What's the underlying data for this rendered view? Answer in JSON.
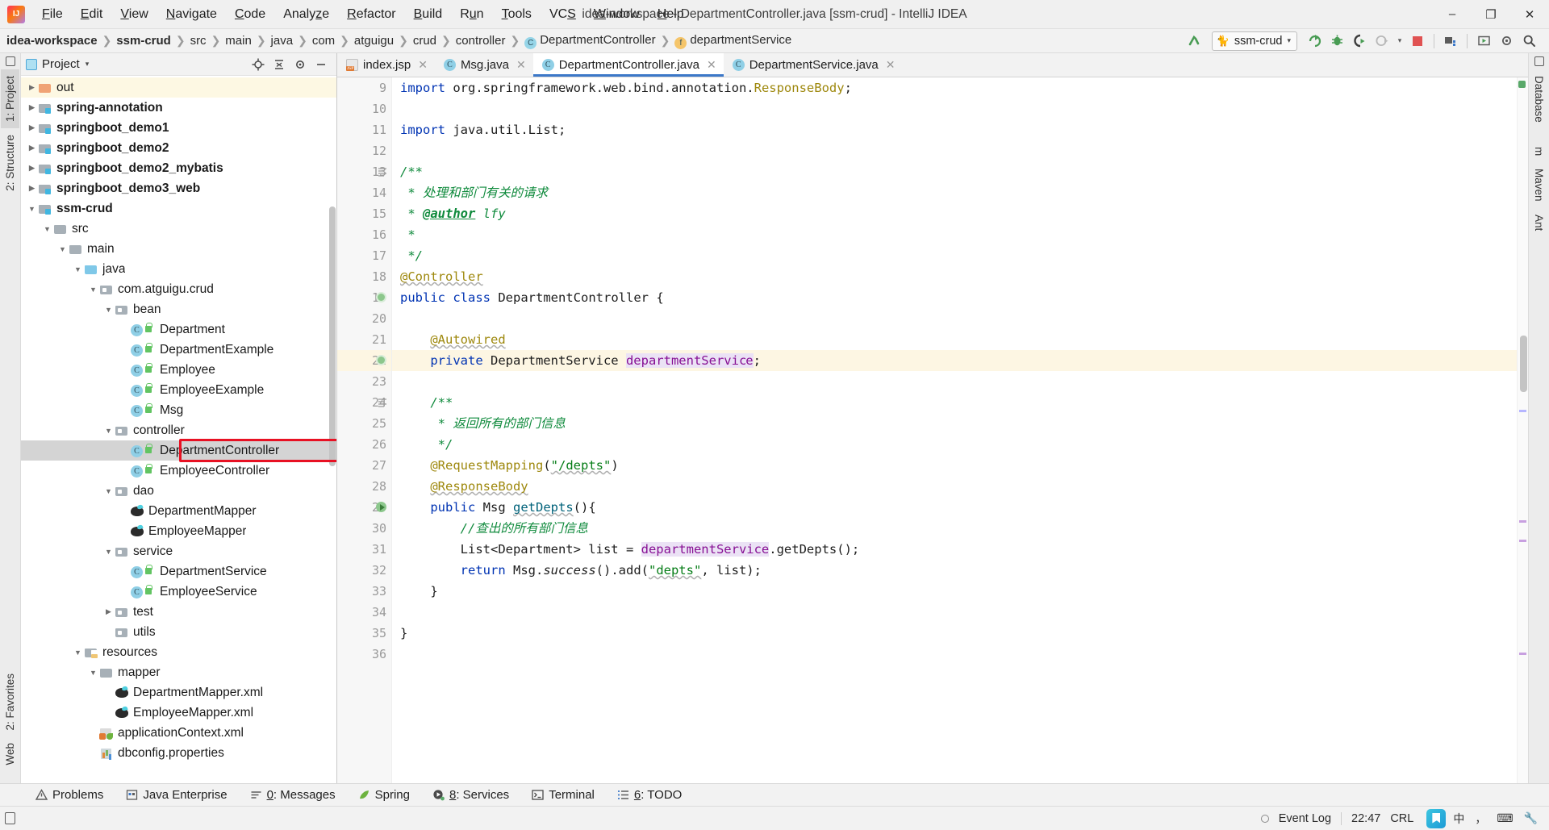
{
  "window": {
    "title": "idea-workspace - DepartmentController.java [ssm-crud] - IntelliJ IDEA",
    "minimize": "–",
    "maximize": "❐",
    "close": "✕"
  },
  "menubar": [
    {
      "label": "File"
    },
    {
      "label": "Edit"
    },
    {
      "label": "View"
    },
    {
      "label": "Navigate"
    },
    {
      "label": "Code"
    },
    {
      "label": "Analyze"
    },
    {
      "label": "Refactor"
    },
    {
      "label": "Build"
    },
    {
      "label": "Run"
    },
    {
      "label": "Tools"
    },
    {
      "label": "VCS"
    },
    {
      "label": "Window"
    },
    {
      "label": "Help"
    }
  ],
  "breadcrumb": {
    "separator": "❯",
    "items": [
      {
        "label": "idea-workspace",
        "bold": true,
        "icon": ""
      },
      {
        "label": "ssm-crud",
        "bold": true,
        "icon": ""
      },
      {
        "label": "src",
        "bold": false,
        "icon": ""
      },
      {
        "label": "main",
        "bold": false,
        "icon": ""
      },
      {
        "label": "java",
        "bold": false,
        "icon": ""
      },
      {
        "label": "com",
        "bold": false,
        "icon": ""
      },
      {
        "label": "atguigu",
        "bold": false,
        "icon": ""
      },
      {
        "label": "crud",
        "bold": false,
        "icon": ""
      },
      {
        "label": "controller",
        "bold": false,
        "icon": ""
      },
      {
        "label": "DepartmentController",
        "bold": false,
        "icon": "class-icon",
        "iconChar": "C"
      },
      {
        "label": "departmentService",
        "bold": false,
        "icon": "field-icon",
        "iconChar": "f"
      }
    ]
  },
  "toolbar": {
    "run_config": {
      "label": "ssm-crud",
      "icon": "tomcat-cat-icon",
      "chevron": "▾"
    },
    "buttons": [
      {
        "name": "make-project-icon",
        "glyph": "↖"
      },
      {
        "name": "run-icon",
        "glyph": "↻"
      },
      {
        "name": "debug-icon",
        "glyph": "☣"
      },
      {
        "name": "run-with-coverage-icon",
        "glyph": "▶"
      },
      {
        "name": "profile-icon",
        "glyph": "◴"
      },
      {
        "name": "profile-dropdown-icon",
        "glyph": "▾"
      },
      {
        "name": "stop-icon",
        "glyph": "■"
      },
      {
        "name": "project-structure-icon",
        "glyph": "▤"
      },
      {
        "name": "update-icon",
        "glyph": "▷"
      },
      {
        "name": "settings-icon",
        "glyph": "⚙"
      },
      {
        "name": "search-icon",
        "glyph": "⚲"
      }
    ]
  },
  "left_rail": [
    {
      "label": "1: Project",
      "active": true,
      "name": "rail-tab-project"
    },
    {
      "label": "2: Structure",
      "active": false,
      "name": "rail-tab-structure"
    },
    {
      "label": "2: Favorites",
      "active": false,
      "name": "rail-tab-favorites"
    },
    {
      "label": "Web",
      "active": false,
      "name": "rail-tab-web"
    }
  ],
  "right_rail": [
    {
      "label": "Database",
      "name": "rail-tab-database"
    },
    {
      "label": "m",
      "name": "rail-tab-maven-m"
    },
    {
      "label": "Maven",
      "name": "rail-tab-maven"
    },
    {
      "label": "Ant",
      "name": "rail-tab-ant"
    }
  ],
  "project_panel": {
    "title": "Project",
    "chevron": "▾",
    "icons": [
      {
        "name": "locate-file-icon",
        "glyph": "⊕"
      },
      {
        "name": "collapse-all-icon",
        "glyph": "≡"
      },
      {
        "name": "settings-icon",
        "glyph": "⚙"
      },
      {
        "name": "hide-icon",
        "glyph": "—"
      }
    ],
    "tree": [
      {
        "label": "out",
        "indent": 1,
        "arrow": "right",
        "icon": "folder-out",
        "bold": false,
        "state": "yellow"
      },
      {
        "label": "spring-annotation",
        "indent": 1,
        "arrow": "right",
        "icon": "folder-module",
        "bold": true,
        "state": ""
      },
      {
        "label": "springboot_demo1",
        "indent": 1,
        "arrow": "right",
        "icon": "folder-module",
        "bold": true,
        "state": ""
      },
      {
        "label": "springboot_demo2",
        "indent": 1,
        "arrow": "right",
        "icon": "folder-module",
        "bold": true,
        "state": ""
      },
      {
        "label": "springboot_demo2_mybatis",
        "indent": 1,
        "arrow": "right",
        "icon": "folder-module",
        "bold": true,
        "state": ""
      },
      {
        "label": "springboot_demo3_web",
        "indent": 1,
        "arrow": "right",
        "icon": "folder-module",
        "bold": true,
        "state": ""
      },
      {
        "label": "ssm-crud",
        "indent": 1,
        "arrow": "down",
        "icon": "folder-module",
        "bold": true,
        "state": ""
      },
      {
        "label": "src",
        "indent": 2,
        "arrow": "down",
        "icon": "folder-plain",
        "bold": false,
        "state": ""
      },
      {
        "label": "main",
        "indent": 3,
        "arrow": "down",
        "icon": "folder-plain",
        "bold": false,
        "state": ""
      },
      {
        "label": "java",
        "indent": 4,
        "arrow": "down",
        "icon": "folder-source",
        "bold": false,
        "state": ""
      },
      {
        "label": "com.atguigu.crud",
        "indent": 5,
        "arrow": "down",
        "icon": "folder-package",
        "bold": false,
        "state": ""
      },
      {
        "label": "bean",
        "indent": 6,
        "arrow": "down",
        "icon": "folder-package",
        "bold": false,
        "state": ""
      },
      {
        "label": "Department",
        "indent": 7,
        "arrow": "",
        "icon": "java-class",
        "bold": false,
        "state": ""
      },
      {
        "label": "DepartmentExample",
        "indent": 7,
        "arrow": "",
        "icon": "java-class",
        "bold": false,
        "state": ""
      },
      {
        "label": "Employee",
        "indent": 7,
        "arrow": "",
        "icon": "java-class",
        "bold": false,
        "state": ""
      },
      {
        "label": "EmployeeExample",
        "indent": 7,
        "arrow": "",
        "icon": "java-class",
        "bold": false,
        "state": ""
      },
      {
        "label": "Msg",
        "indent": 7,
        "arrow": "",
        "icon": "java-class",
        "bold": false,
        "state": ""
      },
      {
        "label": "controller",
        "indent": 6,
        "arrow": "down",
        "icon": "folder-package",
        "bold": false,
        "state": ""
      },
      {
        "label": "DepartmentController",
        "indent": 7,
        "arrow": "",
        "icon": "java-class",
        "bold": false,
        "state": "selected"
      },
      {
        "label": "EmployeeController",
        "indent": 7,
        "arrow": "",
        "icon": "java-class",
        "bold": false,
        "state": ""
      },
      {
        "label": "dao",
        "indent": 6,
        "arrow": "down",
        "icon": "folder-package",
        "bold": false,
        "state": ""
      },
      {
        "label": "DepartmentMapper",
        "indent": 7,
        "arrow": "",
        "icon": "mybatis",
        "bold": false,
        "state": ""
      },
      {
        "label": "EmployeeMapper",
        "indent": 7,
        "arrow": "",
        "icon": "mybatis",
        "bold": false,
        "state": ""
      },
      {
        "label": "service",
        "indent": 6,
        "arrow": "down",
        "icon": "folder-package",
        "bold": false,
        "state": ""
      },
      {
        "label": "DepartmentService",
        "indent": 7,
        "arrow": "",
        "icon": "java-class",
        "bold": false,
        "state": ""
      },
      {
        "label": "EmployeeService",
        "indent": 7,
        "arrow": "",
        "icon": "java-class",
        "bold": false,
        "state": ""
      },
      {
        "label": "test",
        "indent": 6,
        "arrow": "right",
        "icon": "folder-package",
        "bold": false,
        "state": ""
      },
      {
        "label": "utils",
        "indent": 6,
        "arrow": "",
        "icon": "folder-package",
        "bold": false,
        "state": ""
      },
      {
        "label": "resources",
        "indent": 4,
        "arrow": "down",
        "icon": "folder-resource",
        "bold": false,
        "state": ""
      },
      {
        "label": "mapper",
        "indent": 5,
        "arrow": "down",
        "icon": "folder-plain",
        "bold": false,
        "state": ""
      },
      {
        "label": "DepartmentMapper.xml",
        "indent": 6,
        "arrow": "",
        "icon": "mybatis",
        "bold": false,
        "state": ""
      },
      {
        "label": "EmployeeMapper.xml",
        "indent": 6,
        "arrow": "",
        "icon": "mybatis",
        "bold": false,
        "state": ""
      },
      {
        "label": "applicationContext.xml",
        "indent": 5,
        "arrow": "",
        "icon": "spring-xml",
        "bold": false,
        "state": ""
      },
      {
        "label": "dbconfig.properties",
        "indent": 5,
        "arrow": "",
        "icon": "properties",
        "bold": false,
        "state": ""
      }
    ]
  },
  "editor": {
    "tabs": [
      {
        "label": "index.jsp",
        "icon": "jsp-icon",
        "iconChar": "",
        "active": false,
        "close": "✕"
      },
      {
        "label": "Msg.java",
        "icon": "class-icon",
        "iconChar": "C",
        "active": false,
        "close": "✕"
      },
      {
        "label": "DepartmentController.java",
        "icon": "class-icon",
        "iconChar": "C",
        "active": true,
        "close": "✕"
      },
      {
        "label": "DepartmentService.java",
        "icon": "class-icon",
        "iconChar": "C",
        "active": false,
        "close": "✕"
      }
    ],
    "first_line_number": 9,
    "lines": [
      {
        "n": 9,
        "text": "import org.springframework.web.bind.annotation.ResponseBody;",
        "highlight": false
      },
      {
        "n": 10,
        "text": "",
        "highlight": false
      },
      {
        "n": 11,
        "text": "import java.util.List;",
        "highlight": false
      },
      {
        "n": 12,
        "text": "",
        "highlight": false
      },
      {
        "n": 13,
        "text": "/**",
        "highlight": false
      },
      {
        "n": 14,
        "text": " * 处理和部门有关的请求",
        "highlight": false
      },
      {
        "n": 15,
        "text": " * @author lfy",
        "highlight": false
      },
      {
        "n": 16,
        "text": " *",
        "highlight": false
      },
      {
        "n": 17,
        "text": " */",
        "highlight": false
      },
      {
        "n": 18,
        "text": "@Controller",
        "highlight": false
      },
      {
        "n": 19,
        "text": "public class DepartmentController {",
        "highlight": false
      },
      {
        "n": 20,
        "text": "",
        "highlight": false
      },
      {
        "n": 21,
        "text": "    @Autowired",
        "highlight": false
      },
      {
        "n": 22,
        "text": "    private DepartmentService departmentService;",
        "highlight": true
      },
      {
        "n": 23,
        "text": "",
        "highlight": false
      },
      {
        "n": 24,
        "text": "    /**",
        "highlight": false
      },
      {
        "n": 25,
        "text": "     * 返回所有的部门信息",
        "highlight": false
      },
      {
        "n": 26,
        "text": "     */",
        "highlight": false
      },
      {
        "n": 27,
        "text": "    @RequestMapping(\"/depts\")",
        "highlight": false
      },
      {
        "n": 28,
        "text": "    @ResponseBody",
        "highlight": false
      },
      {
        "n": 29,
        "text": "    public Msg getDepts(){",
        "highlight": false
      },
      {
        "n": 30,
        "text": "        //查出的所有部门信息",
        "highlight": false
      },
      {
        "n": 31,
        "text": "        List<Department> list = departmentService.getDepts();",
        "highlight": false
      },
      {
        "n": 32,
        "text": "        return Msg.success().add(\"depts\", list);",
        "highlight": false
      },
      {
        "n": 33,
        "text": "    }",
        "highlight": false
      },
      {
        "n": 34,
        "text": "",
        "highlight": false
      },
      {
        "n": 35,
        "text": "}",
        "highlight": false
      },
      {
        "n": 36,
        "text": "",
        "highlight": false
      }
    ]
  },
  "toolwindow_bar": [
    {
      "label": "Problems",
      "icon": "warning-icon",
      "mnemonic": ""
    },
    {
      "label": "Java Enterprise",
      "icon": "java-enterprise-icon",
      "mnemonic": ""
    },
    {
      "label": "0: Messages",
      "icon": "messages-icon",
      "mnemonic": "0"
    },
    {
      "label": "Spring",
      "icon": "spring-leaf-icon",
      "mnemonic": ""
    },
    {
      "label": "8: Services",
      "icon": "services-icon",
      "mnemonic": "8"
    },
    {
      "label": "Terminal",
      "icon": "terminal-icon",
      "mnemonic": ""
    },
    {
      "label": "6: TODO",
      "icon": "todo-icon",
      "mnemonic": "6"
    }
  ],
  "statusbar": {
    "event_log": "Event Log",
    "time": "22:47",
    "crl": "CRL",
    "ime_lang": "中",
    "ime_punct": "，",
    "ime_keyboard": "⌨",
    "ime_tool": "🔧"
  },
  "colors": {
    "accent": "#3c78c8",
    "annotation_rect": "#e81123",
    "selection": "#d4d4d4",
    "highlight_line": "#fdf6e3",
    "keyword": "#0033b3",
    "string": "#067d17",
    "comment": "#8c8c8c",
    "javadoc": "#0f8a3c",
    "field": "#871094",
    "annotation_text": "#9e880d",
    "method": "#00627a"
  }
}
